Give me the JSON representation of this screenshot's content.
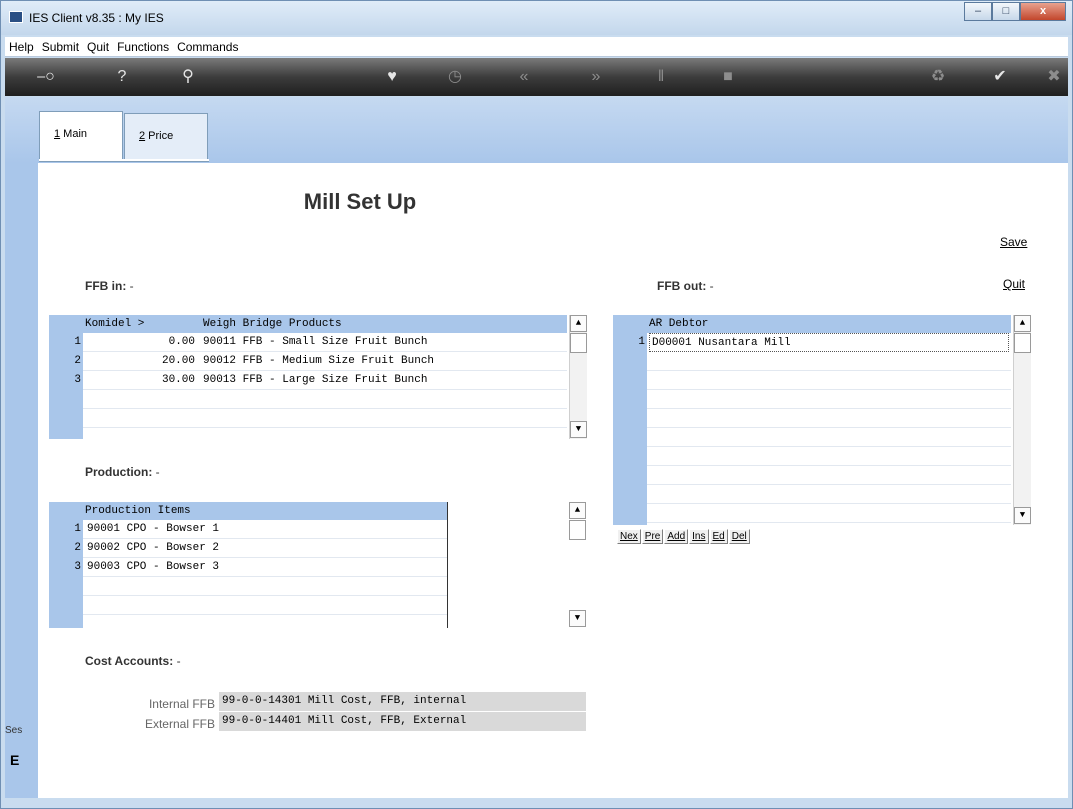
{
  "window": {
    "title": "IES Client v8.35 : My IES"
  },
  "menu": [
    "Help",
    "Submit",
    "Quit",
    "Functions",
    "Commands"
  ],
  "toolbar_icons": [
    "key-icon",
    "help-icon",
    "search-icon",
    "heart-icon",
    "clock-icon",
    "rewind-icon",
    "forward-icon",
    "tools-icon",
    "stop-icon",
    "recycle-icon",
    "check-icon",
    "close-icon"
  ],
  "tabs": [
    {
      "label_accel": "1",
      "label_rest": " Main"
    },
    {
      "label_accel": "2",
      "label_rest": " Price"
    }
  ],
  "page": {
    "title": "Mill Set Up",
    "save": "Save",
    "quit": "Quit"
  },
  "ffb_in": {
    "label": "FFB in:",
    "dash": " -",
    "col_komidel": "Komidel >",
    "col_products": "Weigh Bridge Products",
    "rows": [
      {
        "num": "1",
        "komidel": "0.00",
        "product": "90011 FFB - Small Size Fruit Bunch"
      },
      {
        "num": "2",
        "komidel": "20.00",
        "product": "90012 FFB - Medium Size Fruit Bunch"
      },
      {
        "num": "3",
        "komidel": "30.00",
        "product": "90013 FFB - Large Size Fruit Bunch"
      }
    ]
  },
  "ffb_out": {
    "label": "FFB out:",
    "dash": " -",
    "col": "AR Debtor",
    "rows": [
      {
        "num": "1",
        "value": "D00001 Nusantara Mill"
      }
    ]
  },
  "nav_buttons": [
    "Nex",
    "Pre",
    "Add",
    "Ins",
    "Ed",
    "Del"
  ],
  "production": {
    "label": "Production:",
    "dash": " -",
    "col": "Production Items",
    "rows": [
      {
        "num": "1",
        "value": "90001 CPO - Bowser 1"
      },
      {
        "num": "2",
        "value": "90002 CPO - Bowser 2"
      },
      {
        "num": "3",
        "value": "90003 CPO - Bowser 3"
      }
    ]
  },
  "cost_accounts": {
    "label": "Cost Accounts:",
    "dash": " -",
    "internal_label": "Internal FFB",
    "internal_value": "99-0-0-14301 Mill Cost, FFB, internal",
    "external_label": "External FFB",
    "external_value": "99-0-0-14401 Mill Cost, FFB, External"
  },
  "sidebar": {
    "ses": "Ses",
    "icon_glyph": "E"
  }
}
